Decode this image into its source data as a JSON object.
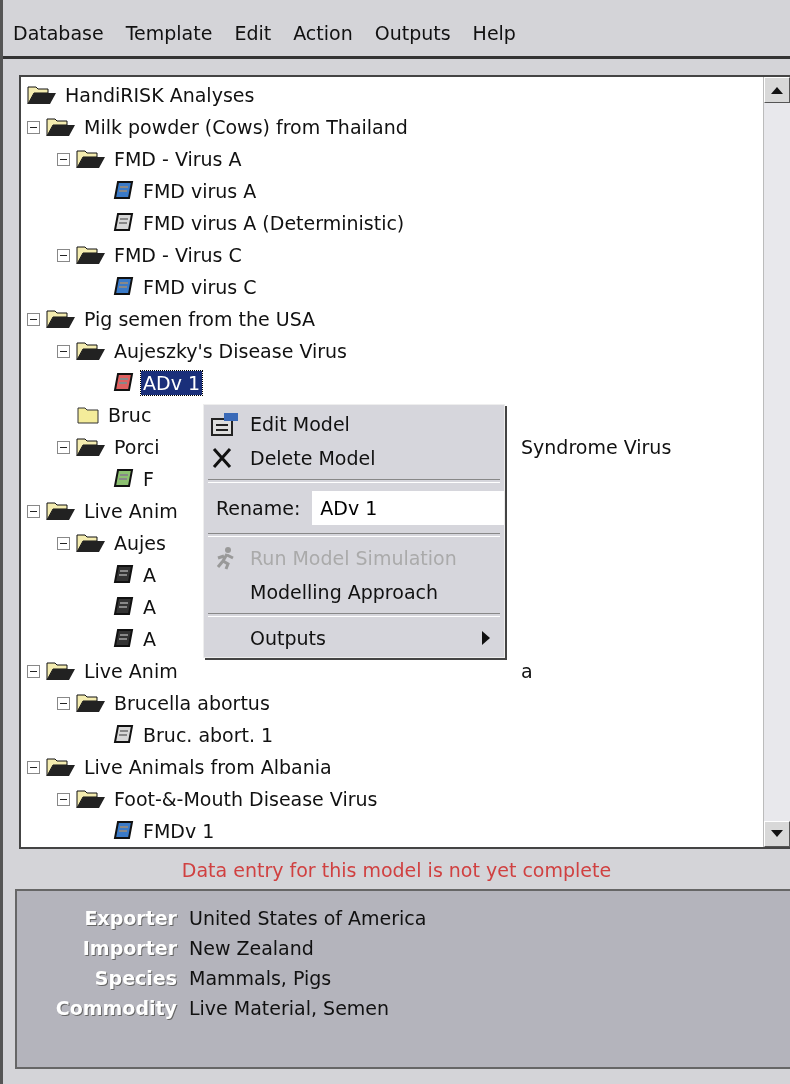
{
  "menu_bar": [
    {
      "label": "Database"
    },
    {
      "label": "Template"
    },
    {
      "label": "Edit"
    },
    {
      "label": "Action"
    },
    {
      "label": "Outputs"
    },
    {
      "label": "Help"
    }
  ],
  "tree": [
    {
      "label": "HandiRISK Analyses",
      "kind": "root",
      "children": [
        {
          "label": "Milk powder (Cows) from Thailand",
          "kind": "folder",
          "expanded": true,
          "children": [
            {
              "label": "FMD - Virus A",
              "kind": "folder",
              "expanded": true,
              "children": [
                {
                  "label": "FMD virus A",
                  "kind": "model",
                  "color": "#3a7ac8",
                  "selected": false
                },
                {
                  "label": "FMD virus A (Deterministic)",
                  "kind": "model",
                  "color": "#d8d8d8",
                  "selected": false
                }
              ]
            },
            {
              "label": "FMD - Virus C",
              "kind": "folder",
              "expanded": true,
              "children": [
                {
                  "label": "FMD virus C",
                  "kind": "model",
                  "color": "#3a7ac8",
                  "selected": false
                }
              ]
            }
          ]
        },
        {
          "label": "Pig semen from the USA",
          "kind": "folder",
          "expanded": true,
          "children": [
            {
              "label": "Aujeszky's Disease Virus",
              "kind": "folder",
              "expanded": true,
              "children": [
                {
                  "label": "ADv 1",
                  "kind": "model",
                  "color": "#e06060",
                  "selected": true
                }
              ]
            },
            {
              "label": "Bruc",
              "kind": "folder",
              "expanded": false
            },
            {
              "label": "Porci",
              "tail": "Syndrome Virus",
              "kind": "folder",
              "expanded": true,
              "children": [
                {
                  "label": "F",
                  "kind": "model",
                  "color": "#8cc070",
                  "selected": false
                }
              ]
            }
          ]
        },
        {
          "label": "Live Anim",
          "kind": "folder",
          "expanded": true,
          "children": [
            {
              "label": "Aujes",
              "kind": "folder",
              "expanded": true,
              "children": [
                {
                  "label": "A",
                  "kind": "model",
                  "color": "#333333",
                  "selected": false
                },
                {
                  "label": "A",
                  "kind": "model",
                  "color": "#333333",
                  "selected": false
                },
                {
                  "label": "A",
                  "kind": "model",
                  "color": "#333333",
                  "selected": false
                }
              ]
            }
          ]
        },
        {
          "label": "Live Anim",
          "tail": "a",
          "kind": "folder",
          "expanded": true,
          "children": [
            {
              "label": "Brucella abortus",
              "kind": "folder",
              "expanded": true,
              "children": [
                {
                  "label": "Bruc. abort. 1",
                  "kind": "model",
                  "color": "#d8d8d8",
                  "selected": false
                }
              ]
            }
          ]
        },
        {
          "label": "Live Animals from Albania",
          "kind": "folder",
          "expanded": true,
          "children": [
            {
              "label": "Foot-&-Mouth Disease Virus",
              "kind": "folder",
              "expanded": true,
              "children": [
                {
                  "label": "FMDv 1",
                  "kind": "model",
                  "color": "#3a7ac8",
                  "selected": false
                }
              ]
            }
          ]
        }
      ]
    }
  ],
  "context_menu": [
    {
      "kind": "edit",
      "label": "Edit Model",
      "disabled": false
    },
    {
      "kind": "delete",
      "label": "Delete Model",
      "disabled": false
    },
    {
      "kind": "separator"
    },
    {
      "kind": "rename",
      "label": "Rename:",
      "value": "ADv 1"
    },
    {
      "kind": "separator"
    },
    {
      "kind": "run",
      "label": "Run Model Simulation",
      "disabled": true
    },
    {
      "kind": "plain",
      "label": "Modelling Approach",
      "disabled": false
    },
    {
      "kind": "separator"
    },
    {
      "kind": "submenu",
      "label": "Outputs",
      "disabled": false
    }
  ],
  "status_message": "Data entry for this model is not yet complete",
  "details": [
    {
      "label": "Exporter",
      "value": "United States of America"
    },
    {
      "label": "Importer",
      "value": "New Zealand"
    },
    {
      "label": "Species",
      "value": "Mammals, Pigs"
    },
    {
      "label": "Commodity",
      "value": "Live Material, Semen"
    }
  ]
}
